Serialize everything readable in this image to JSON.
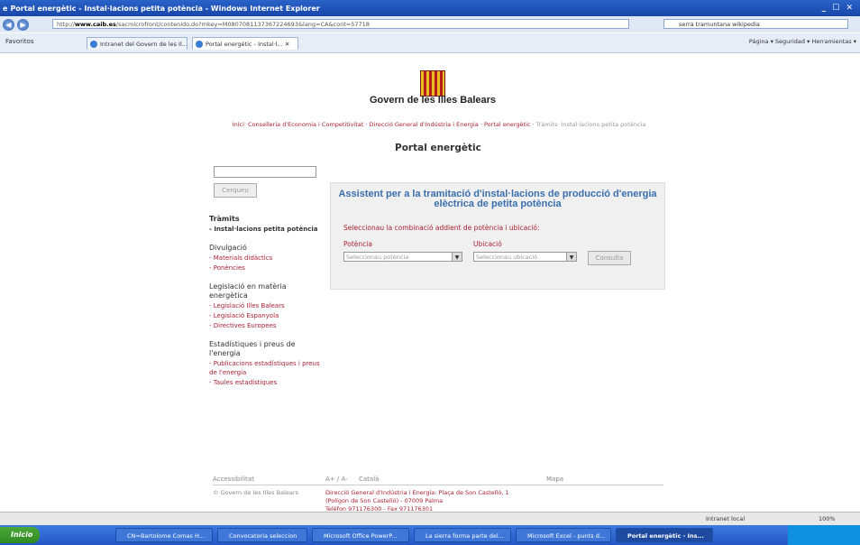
{
  "window": {
    "title": "Portal energètic - Instal·lacions petita potència - Windows Internet Explorer",
    "controls": "_ ☐ ✕"
  },
  "address": {
    "url_host": "www.caib.es",
    "url_rest": "/sacmicrofront/contenido.do?mkey=M0807081137367224693&lang=CA&cont=57718",
    "url_prefix": "http://",
    "search": "serra tramuntana wikipedia"
  },
  "tabs": {
    "favorites": "Favoritos",
    "items": [
      {
        "label": "Intranet del Govern de les Il..."
      },
      {
        "label": "Portal energètic - Instal·l... ✕"
      }
    ],
    "commands": "Página ▾   Seguridad ▾   Herramientas ▾"
  },
  "header": {
    "gov": "Govern de les Illes Balears",
    "breadcrumb_red": "Inici· Conselleria d'Economia i Competitivitat · Direcció General d'Indústria i Energia · Portal energètic ·",
    "breadcrumb_light": "Tràmits· Instal·lacions petita potència",
    "portal_title": "Portal energètic"
  },
  "search": {
    "button": "Cerqueu"
  },
  "sidebar": {
    "tramits": {
      "title": "Tràmits",
      "items": [
        "- Instal·lacions petita potència"
      ]
    },
    "divulgacio": {
      "title": "Divulgació",
      "items": [
        "- Materials didàctics",
        "- Ponències"
      ]
    },
    "legislacio": {
      "title": "Legislació en matèria energètica",
      "items": [
        "- Legislació Illes Balears",
        "- Legislació Espanyola",
        "- Directives Europees"
      ]
    },
    "estadistiques": {
      "title": "Estadístiques i preus de l'energia",
      "items": [
        "- Publicacions estadístiques i preus de l'energia",
        "- Taules estadístiques"
      ]
    }
  },
  "assistant": {
    "title": "Assistent per a la tramitació d'instal·lacions de producció d'energia elèctrica de petita potència",
    "instruction": "Seleccionau la combinació addient de potència i ubicació:",
    "potencia_label": "Potència",
    "potencia_value": "Seleccionau potència",
    "ubicacio_label": "Ubicació",
    "ubicacio_value": "Seleccionau ubicació",
    "button": "Consulta"
  },
  "footer": {
    "accessibilitat": "Accessibilitat",
    "font": "A+ / A-",
    "lang": "Català",
    "map": "Mapa",
    "copyright": "© Govern de les Illes Balears",
    "address1": "Direcció General d'Indústria i Energia: Plaça de Son Castelló, 1",
    "address2": "(Polígon de Son Castelló) - 07009 Palma",
    "address3": "Telèfon 971176300 - Fax 971176301"
  },
  "status": {
    "zone": "Intranet local",
    "zoom": "100%"
  },
  "taskbar": {
    "start": "Inicio",
    "items": [
      "CN=Bartolome Comas H...",
      "Convocatoria seleccion",
      "Microsoft Office PowerP...",
      "La sierra forma parte del...",
      "Microsoft Excel - punts d...",
      "Portal energètic - Ins..."
    ]
  }
}
